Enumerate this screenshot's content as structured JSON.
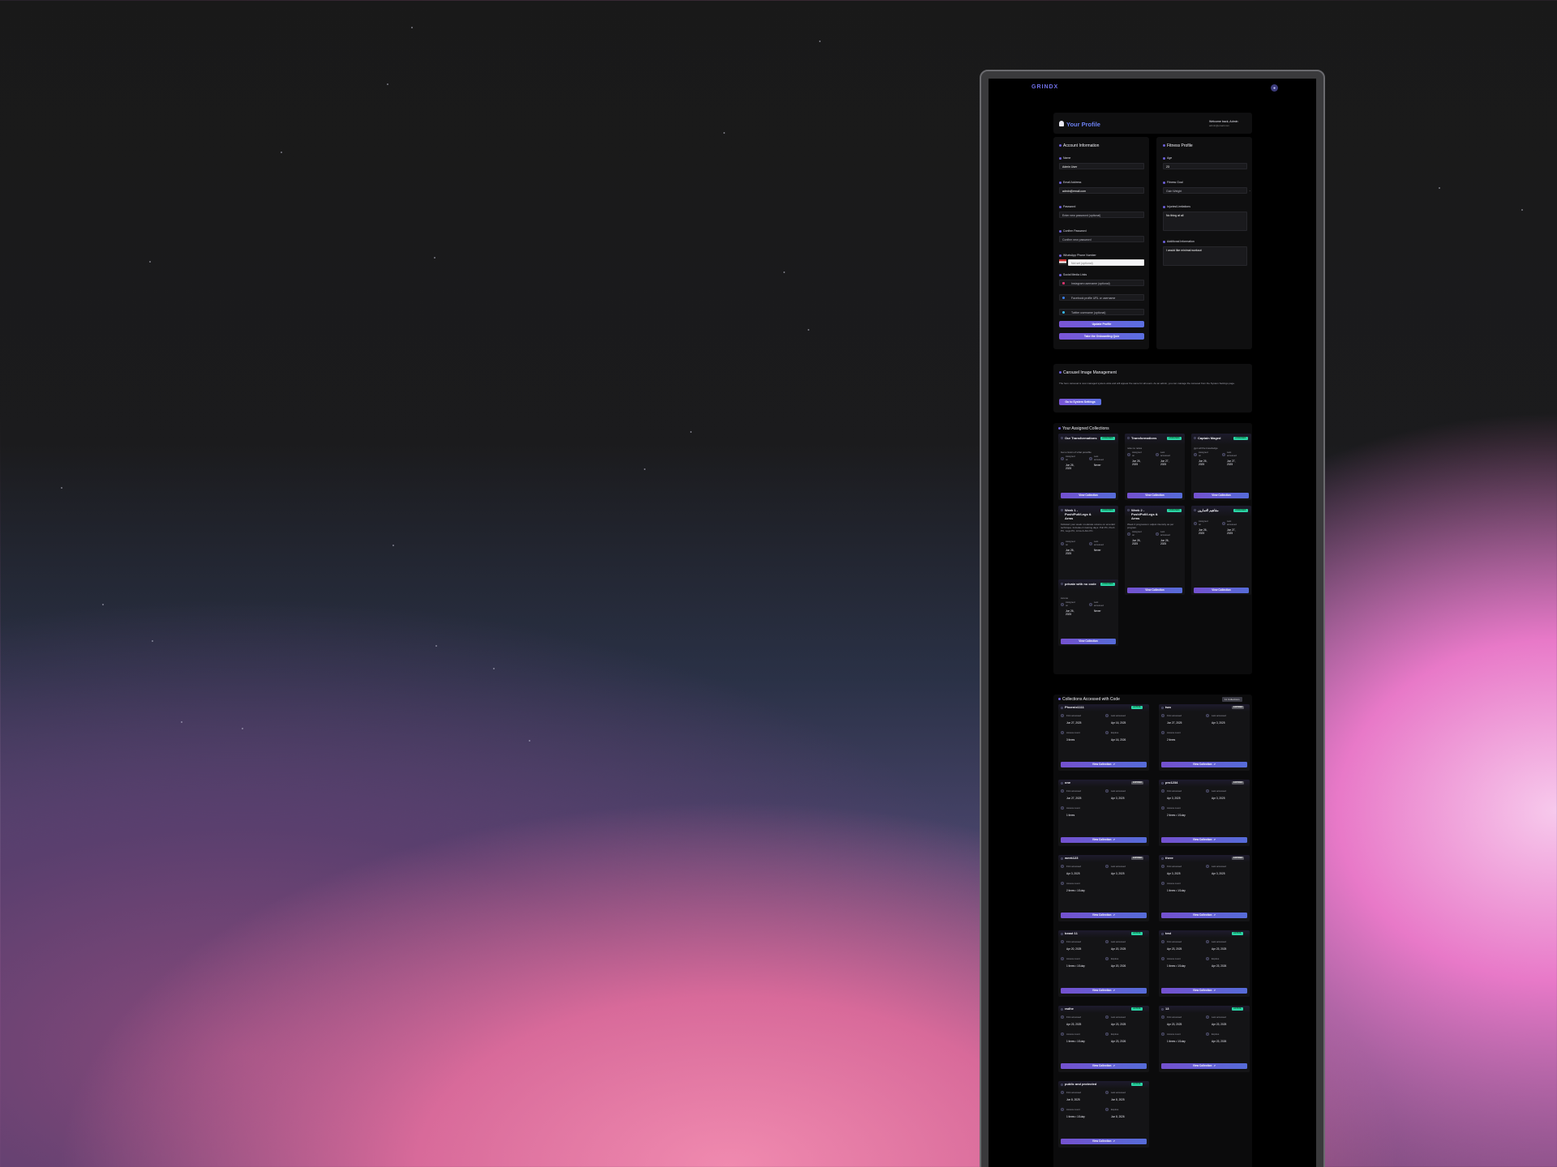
{
  "app": {
    "logo": "GRINDX"
  },
  "header": {
    "title": "Your Profile",
    "welcome": "Welcome back, Admin",
    "email": "admin@email.com"
  },
  "account": {
    "title": "Account Information",
    "name_label": "Name",
    "name_value": "Admin User",
    "email_label": "Email Address",
    "email_value": "admin@email.com",
    "password_label": "Password",
    "password_placeholder": "Enter new password (optional)",
    "confirm_label": "Confirm Password",
    "confirm_placeholder": "Confirm new password",
    "whatsapp_label": "WhatsApp Phone Number",
    "whatsapp_placeholder": "Not set (optional)",
    "social_label": "Social Media Links",
    "instagram_placeholder": "Instagram username (optional)",
    "facebook_placeholder": "Facebook profile URL or username",
    "twitter_placeholder": "Twitter username (optional)",
    "update_button": "Update Profile",
    "quiz_button": "Take the Onboarding Quiz"
  },
  "fitness": {
    "title": "Fitness Profile",
    "age_label": "Age",
    "age_value": "23",
    "goal_label": "Fitness Goal",
    "goal_value": "Gain Weight",
    "injuries_label": "Injuries/Limitations",
    "injuries_value": "No thing at all",
    "additional_label": "Additional Information",
    "additional_value": "I would like minimal workout"
  },
  "carousel": {
    "title": "Carousel Image Management",
    "desc": "The hero carousel is now managed system-wide and will appear the same for all users. As an admin, you can manage the carousel from the System Settings page.",
    "button": "Go to System Settings"
  },
  "assigned": {
    "title": "Your Assigned Collections",
    "badge": "ASSIGNED",
    "assigned_on": "Assigned on",
    "last_accessed": "Last accessed",
    "view": "View Collection",
    "cards": [
      {
        "title": "Our Transformations",
        "desc": "Get a Grain of what possible",
        "assigned": "Jun 26, 2025",
        "last": "Never"
      },
      {
        "title": "Transformations",
        "desc": "note no notes",
        "assigned": "Jun 26, 2025",
        "last": "Jun 27, 2025"
      },
      {
        "title": "Captain Maged",
        "desc": "gym all the knowledge",
        "assigned": "Jun 26, 2025",
        "last": "Jun 27, 2025"
      },
      {
        "title": "Week 1 - Push/Pull/Legs & Arms",
        "desc": "Kickstart your week: moderate volume on emerald technique. Includes 4 training days: Pull PC, Push PC, Legs PC, Arms & Abs PC.",
        "assigned": "Jun 26, 2025",
        "last": "Never"
      },
      {
        "title": "Week 2 - Push/Pull/Legs & Arms",
        "desc": "Week 2 progression: adjust intensity as per program.",
        "assigned": "Jun 26, 2025",
        "last": "Jun 26, 2025"
      },
      {
        "title": "مفاهيم التمارين",
        "desc": "",
        "assigned": "Jun 26, 2025",
        "last": "Jun 27, 2025"
      },
      {
        "title": "private with no code",
        "desc": "zerono",
        "assigned": "Jun 26, 2025",
        "last": "Never"
      }
    ]
  },
  "code": {
    "title": "Collections Accessed with Code",
    "count_badge": "11 Collections",
    "first": "First accessed",
    "last": "Last accessed",
    "count": "Access count",
    "expires": "Expires",
    "view": "View Collection",
    "cards": [
      {
        "title": "Phoenix1111",
        "badge": "ACTIVE",
        "first": "Jun 27, 2025",
        "last": "Apr 16, 2025",
        "count": "3 times",
        "expires": "Apr 16, 2026"
      },
      {
        "title": "two",
        "badge": "EXPIRED",
        "first": "Jun 27, 2025",
        "last": "Apr 3, 2025",
        "count": "2 times",
        "expires": ""
      },
      {
        "title": "one",
        "badge": "EXPIRED",
        "first": "Jun 27, 2025",
        "last": "Apr 3, 2025",
        "count": "1 times",
        "expires": ""
      },
      {
        "title": "pro1234",
        "badge": "EXPIRED",
        "first": "Apr 3, 2025",
        "last": "Apr 3, 2025",
        "count": "2 times • 1/1day",
        "expires": ""
      },
      {
        "title": "week123",
        "badge": "EXPIRED",
        "first": "Apr 3, 2025",
        "last": "Apr 3, 2025",
        "count": "2 times • 1/1day",
        "expires": ""
      },
      {
        "title": "three",
        "badge": "EXPIRED",
        "first": "Apr 3, 2025",
        "last": "Apr 3, 2025",
        "count": "1 times • 1/1day",
        "expires": ""
      },
      {
        "title": "beast 11",
        "badge": "ACTIVE",
        "first": "Apr 20, 2025",
        "last": "Apr 20, 2025",
        "count": "1 times • 1/1day",
        "expires": "Apr 20, 2026"
      },
      {
        "title": "test",
        "badge": "ACTIVE",
        "first": "Apr 23, 2025",
        "last": "Apr 23, 2025",
        "count": "1 times • 1/1day",
        "expires": "Apr 23, 2026"
      },
      {
        "title": "radhe",
        "badge": "ACTIVE",
        "first": "Apr 23, 2025",
        "last": "Apr 23, 2025",
        "count": "1 times • 1/1day",
        "expires": "Apr 23, 2026"
      },
      {
        "title": "13",
        "badge": "ACTIVE",
        "first": "Apr 23, 2025",
        "last": "Apr 23, 2025",
        "count": "1 times • 1/1day",
        "expires": "Apr 23, 2026"
      },
      {
        "title": "public and protected",
        "badge": "ACTIVE",
        "first": "Jun 8, 2025",
        "last": "Jun 8, 2025",
        "count": "1 times • 1/1day",
        "expires": "Jun 8, 2026"
      }
    ]
  }
}
